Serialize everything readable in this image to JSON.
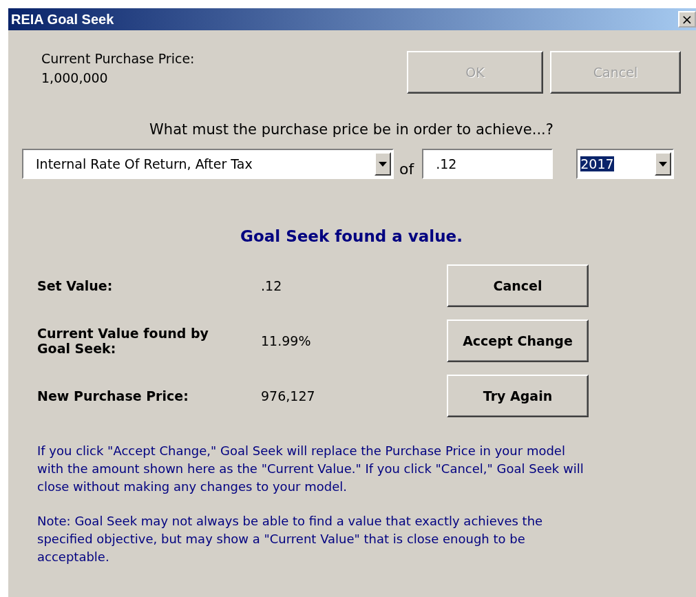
{
  "window": {
    "title": "REIA Goal Seek",
    "close": "×"
  },
  "current": {
    "label": "Current Purchase Price:",
    "value": "1,000,000"
  },
  "top_buttons": [
    {
      "label": "OK",
      "disabled": true
    },
    {
      "label": "Cancel",
      "disabled": true
    }
  ],
  "question": "What must the purchase price be in order to achieve...?",
  "criteria": {
    "metric": "Internal Rate Of Return, After Tax",
    "of": "of",
    "target": ".12",
    "year": {
      "value": "2017",
      "selected": true
    }
  },
  "status": "Goal Seek found a value.",
  "results": [
    {
      "label": "Set Value:",
      "value": ".12",
      "button": "Cancel"
    },
    {
      "label": "Current Value found by Goal Seek:",
      "value": "11.99%",
      "button": "Accept Change"
    },
    {
      "label": "New Purchase Price:",
      "value": "976,127",
      "button": "Try Again"
    }
  ],
  "notes": [
    "If you click \"Accept Change,\" Goal Seek will replace the Purchase Price in your model with the amount shown here as the \"Current Value.\"  If you click \"Cancel,\" Goal Seek will close without making any changes to your model.",
    "Note: Goal Seek may not always be able to find a value that exactly achieves the specified objective, but may show a \"Current Value\" that is close enough to be acceptable."
  ]
}
